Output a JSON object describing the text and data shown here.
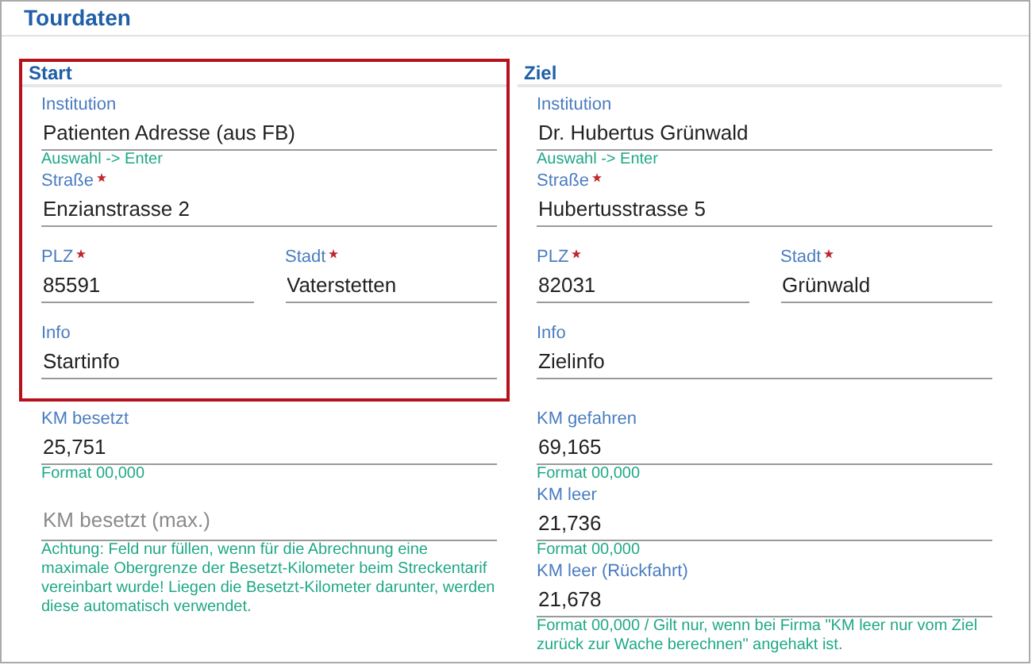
{
  "title": "Tourdaten",
  "columns": [
    {
      "section": {
        "title": "Start",
        "highlighted": true,
        "rows": [
          [
            {
              "label": "Institution",
              "required": false,
              "value": "Patienten Adresse (aus FB)",
              "hint": "Auswahl -> Enter"
            }
          ],
          [
            {
              "label": "Straße",
              "required": true,
              "value": "Enzianstrasse 2"
            }
          ],
          [
            {
              "label": "PLZ",
              "required": true,
              "value": "85591"
            },
            {
              "label": "Stadt",
              "required": true,
              "value": "Vaterstetten"
            }
          ],
          [
            {
              "label": "Info",
              "required": false,
              "value": "Startinfo"
            }
          ]
        ]
      },
      "km_fields": [
        {
          "label": "KM besetzt",
          "required": false,
          "value": "25,751",
          "hint": "Format 00,000"
        },
        {
          "placeholder": "KM besetzt (max.)",
          "hint": "Achtung: Feld nur füllen, wenn für die Abrechnung eine maximale Obergrenze der Besetzt-Kilometer beim Streckentarif vereinbart wurde! Liegen die Besetzt-Kilometer darunter, werden diese automatisch verwendet."
        }
      ]
    },
    {
      "section": {
        "title": "Ziel",
        "highlighted": false,
        "rows": [
          [
            {
              "label": "Institution",
              "required": false,
              "value": "Dr. Hubertus Grünwald",
              "hint": "Auswahl -> Enter"
            }
          ],
          [
            {
              "label": "Straße",
              "required": true,
              "value": "Hubertusstrasse 5"
            }
          ],
          [
            {
              "label": "PLZ",
              "required": true,
              "value": "82031"
            },
            {
              "label": "Stadt",
              "required": true,
              "value": "Grünwald"
            }
          ],
          [
            {
              "label": "Info",
              "required": false,
              "value": "Zielinfo"
            }
          ]
        ]
      },
      "km_fields": [
        {
          "label": "KM gefahren",
          "required": false,
          "value": "69,165",
          "hint": "Format 00,000"
        },
        {
          "label": "KM leer",
          "required": false,
          "value": "21,736",
          "hint": "Format 00,000"
        },
        {
          "label": "KM leer (Rückfahrt)",
          "required": false,
          "value": "21,678",
          "hint": "Format 00,000 / Gilt nur, wenn bei Firma \"KM leer nur vom Ziel zurück zur Wache berechnen\" angehakt ist."
        }
      ]
    }
  ]
}
